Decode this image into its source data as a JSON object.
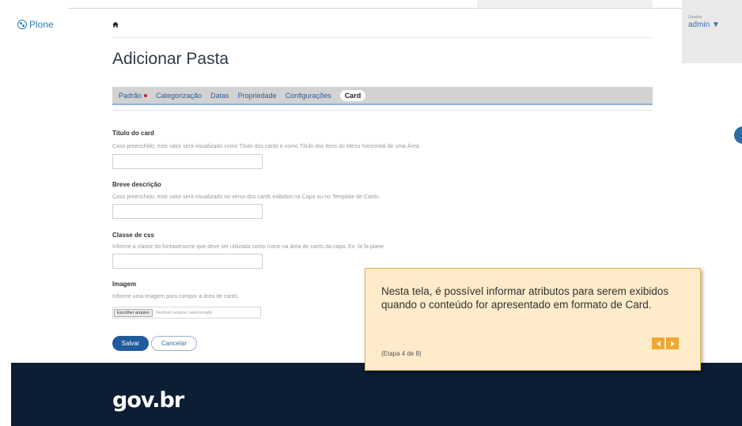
{
  "brand": {
    "plone": "Plone"
  },
  "user": {
    "caption": "Usuário",
    "name": "admin ▼"
  },
  "page": {
    "title": "Adicionar Pasta"
  },
  "tabs": [
    {
      "label": "Padrão",
      "required": true
    },
    {
      "label": "Categorização"
    },
    {
      "label": "Datas"
    },
    {
      "label": "Propriedade"
    },
    {
      "label": "Configurações"
    },
    {
      "label": "Card",
      "active": true
    }
  ],
  "form": {
    "card_title": {
      "label": "Título do card",
      "help": "Caso preenchido, este valor será visualizado como Título dos cards e como Título dos itens do Menu horizontal de uma Área.",
      "value": ""
    },
    "short_description": {
      "label": "Breve descrição",
      "help": "Caso preenchido, este valor será visualizado no verso dos cards exibidos na Capa ou no Template de Cards.",
      "value": ""
    },
    "css_class": {
      "label": "Classe de css",
      "help": "Informe a classe do fontawesome que deve ser utilizada como ícone na área de cards da capa. Ex: fa fa-plane",
      "value": ""
    },
    "image": {
      "label": "Imagem",
      "help": "Informe uma imagem para compor a área de cards.",
      "button": "Escolher arquivo",
      "status": "Nenhum arquivo selecionado"
    },
    "save": "Salvar",
    "cancel": "Cancelar"
  },
  "footer": {
    "logo": "gov.br"
  },
  "tour": {
    "text": "Nesta tela, é possível informar atributos para serem exibidos quando o conteúdo for apresentado em formato de Card.",
    "step": "(Etapa 4 de 8)"
  },
  "colors": {
    "brand_blue": "#1f5b9c",
    "footer_navy": "#0d1d33",
    "tour_bg": "#fdebc9",
    "tour_nav": "#f1a730",
    "required": "#d71a21"
  },
  "icons": {
    "home": "home-icon",
    "plone": "plone-logo-icon",
    "prev": "triangle-left-icon",
    "next": "triangle-right-icon"
  }
}
